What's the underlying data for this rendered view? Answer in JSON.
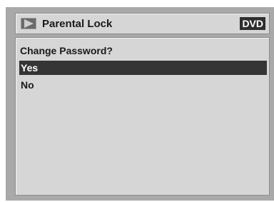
{
  "header": {
    "title": "Parental Lock",
    "disc_type": "DVD",
    "icon": "play-icon"
  },
  "dialog": {
    "question": "Change Password?",
    "options": [
      {
        "label": "Yes",
        "selected": true
      },
      {
        "label": "No",
        "selected": false
      }
    ]
  },
  "colors": {
    "background": "#a9a9a9",
    "panel": "#d6d6d6",
    "highlight": "#353535",
    "badge": "#2e2e2e"
  }
}
